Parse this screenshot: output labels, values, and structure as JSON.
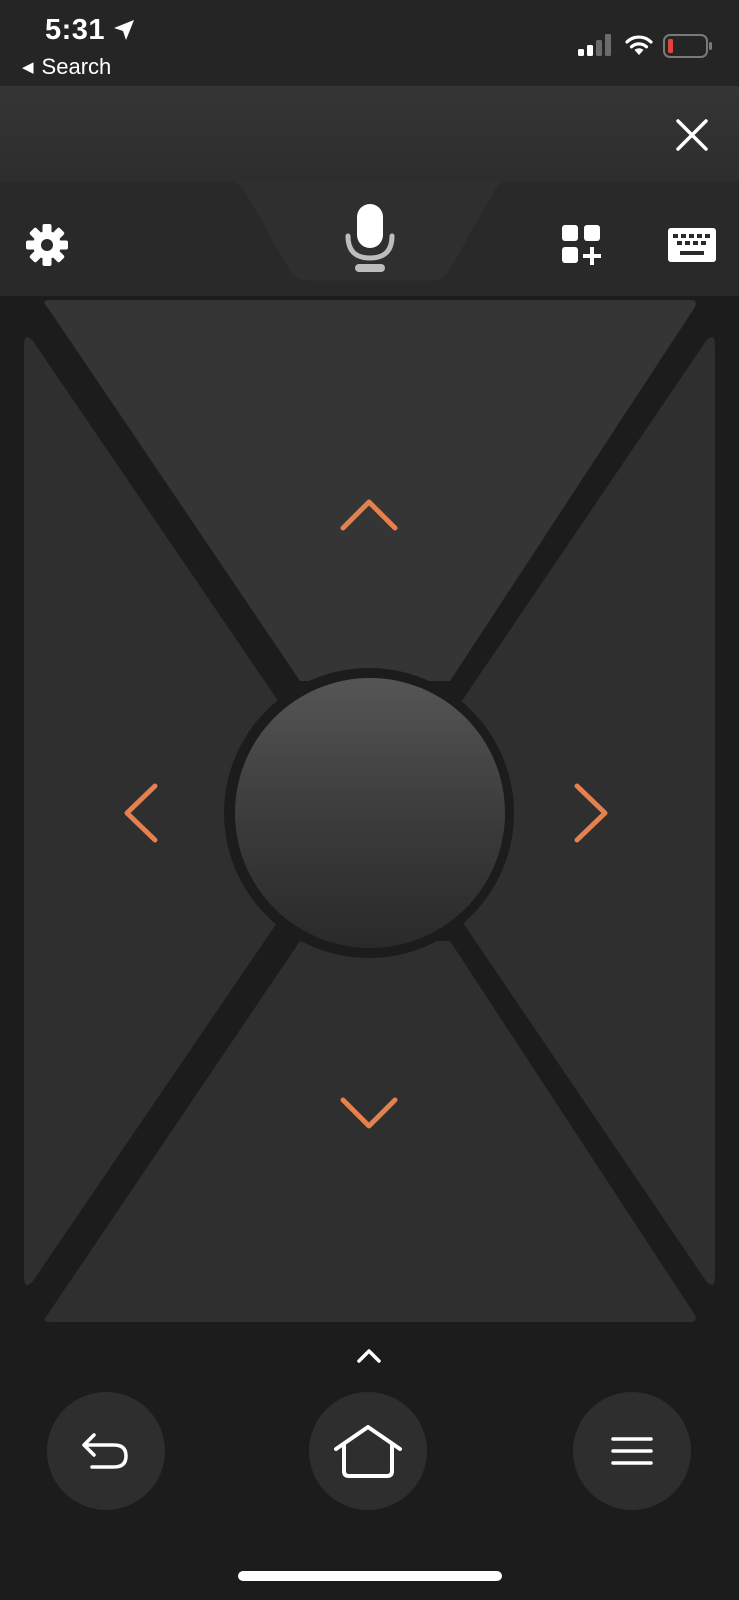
{
  "status_bar": {
    "time": "5:31",
    "back_app_label": "Search",
    "icons": [
      "location-arrow-icon",
      "signal-icon",
      "wifi-icon",
      "battery-low-icon"
    ]
  },
  "header": {
    "close_icon": "close-icon"
  },
  "toolbar": {
    "icons": [
      "gear-icon",
      "microphone-icon",
      "apps-add-icon",
      "keyboard-icon"
    ]
  },
  "dpad": {
    "icons": [
      "chevron-up-icon",
      "chevron-left-icon",
      "chevron-right-icon",
      "chevron-down-icon"
    ],
    "arrow_color": "#e5804f"
  },
  "bottom": {
    "icons": [
      "chevron-up-icon",
      "back-icon",
      "home-icon",
      "menu-icon"
    ]
  },
  "colors": {
    "background": "#1c1c1c",
    "panel": "#2f2f2f",
    "accent": "#e5804f"
  }
}
